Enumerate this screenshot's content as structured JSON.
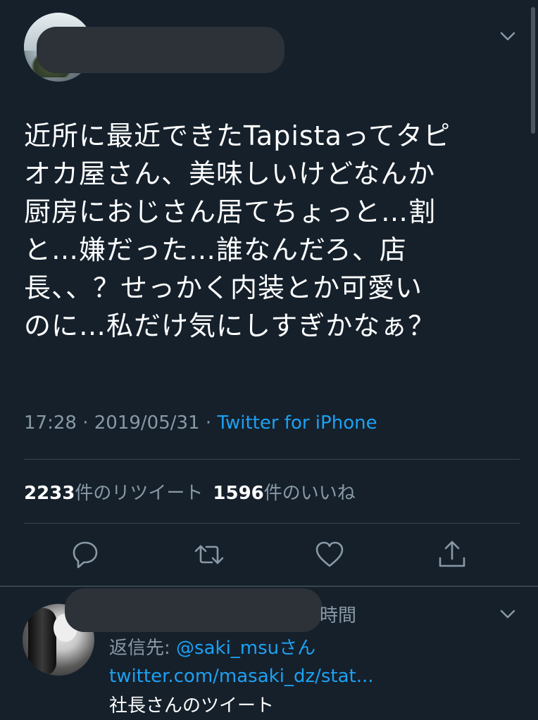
{
  "tweet": {
    "text_lines": [
      "近所に最近できたTapistaってタピ",
      "オカ屋さん、美味しいけどなんか",
      "厨房におじさん居てちょっと…割",
      "と…嫌だった…誰なんだろ、店",
      "長、、？せっかく内装とか可愛い",
      "のに…私だけ気にしすぎかなぁ？"
    ],
    "time": "17:28",
    "separator": " · ",
    "date": "2019/05/31",
    "source": "Twitter for iPhone",
    "retweet_count": "2233",
    "retweet_label": "件のリツイート",
    "like_count": "1596",
    "like_label": "件のいいね"
  },
  "icons": {
    "reply": "reply-icon",
    "retweet": "retweet-icon",
    "like": "heart-icon",
    "share": "share-icon",
    "menu": "chevron-down-icon"
  },
  "reply": {
    "time_suffix": "時間",
    "reply_to_label": "返信先: ",
    "reply_to_handle": "@saki_msu",
    "reply_to_suffix": "さん",
    "link": "twitter.com/masaki_dz/stat...",
    "text": "社長さんのツイート"
  },
  "colors": {
    "background": "#15202b",
    "accent": "#1da1f2",
    "secondary_text": "#8899a6",
    "divider": "#38444d"
  }
}
